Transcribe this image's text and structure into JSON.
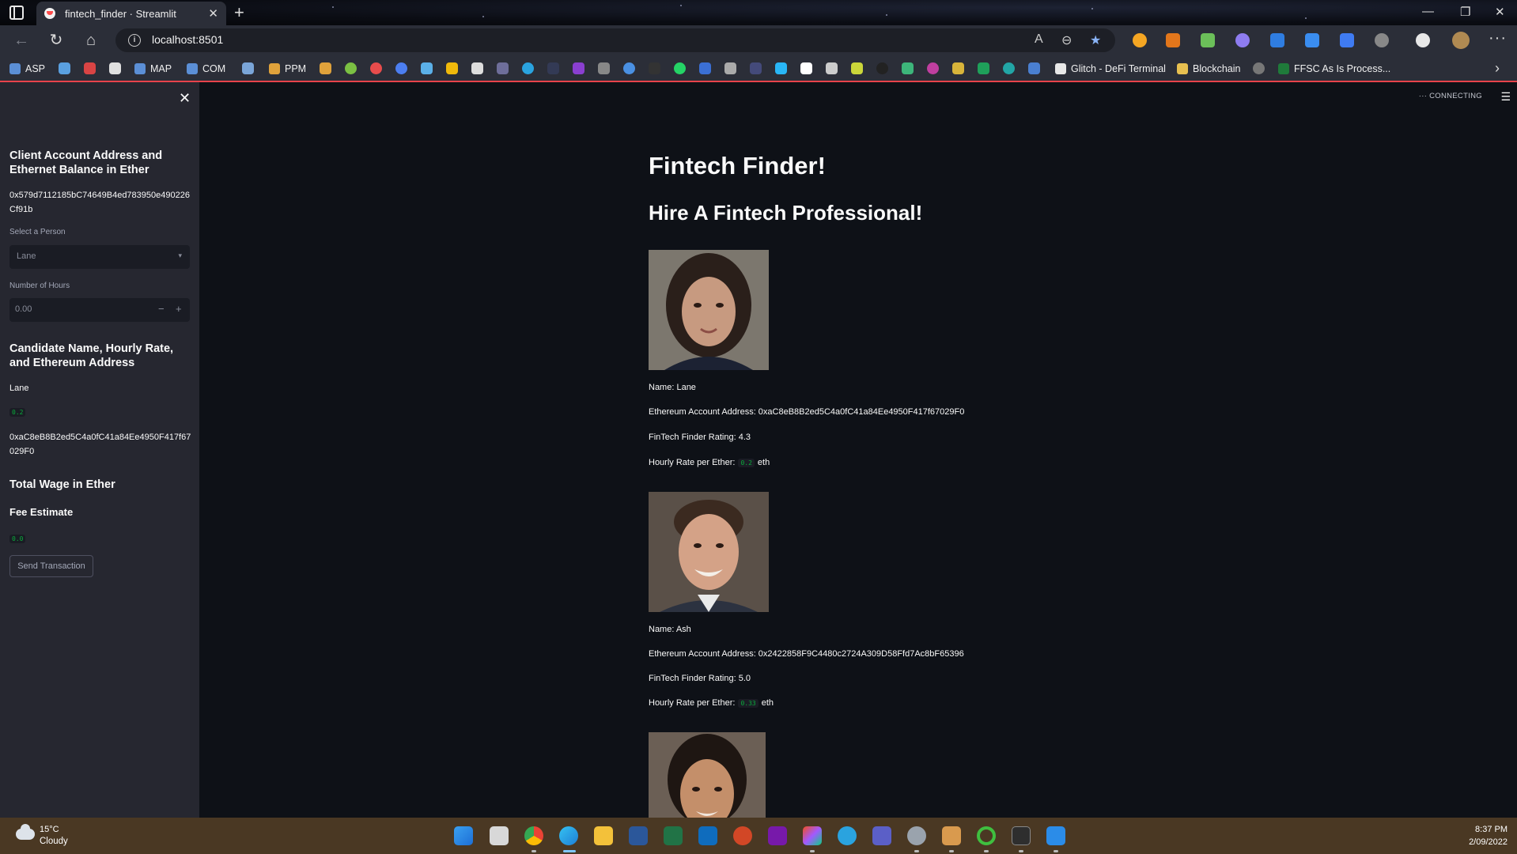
{
  "browser": {
    "tab_title": "fintech_finder · Streamlit",
    "url": "localhost:8501",
    "bookmarks": [
      {
        "label": "ASP",
        "color": "#5b8fd6"
      },
      {
        "label": "MAP",
        "color": "#5b8fd6"
      },
      {
        "label": "COM",
        "color": "#5b8fd6"
      },
      {
        "label": "PPM",
        "color": "#e0a23b"
      },
      {
        "label": "Glitch - DeFi Terminal",
        "color": "#e8e8e8"
      },
      {
        "label": "Blockchain",
        "color": "#e8c050"
      },
      {
        "label": "FFSC As Is Process...",
        "color": "#1f7a3a"
      }
    ]
  },
  "sidebar": {
    "account_heading": "Client Account Address and Ethernet Balance in Ether",
    "account_address": "0x579d7112185bC74649B4ed783950e490226Cf91b",
    "select_label": "Select a Person",
    "select_value": "Lane",
    "hours_label": "Number of Hours",
    "hours_value": "0.00",
    "candidate_heading": "Candidate Name, Hourly Rate, and Ethereum Address",
    "candidate_name": "Lane",
    "candidate_rate": "0.2",
    "candidate_address": "0xaC8eB8B2ed5C4a0fC41a84Ee4950F417f67029F0",
    "wage_heading": "Total Wage in Ether",
    "fee_heading": "Fee Estimate",
    "fee_value": "0.0",
    "send_button": "Send Transaction"
  },
  "main": {
    "status": "CONNECTING",
    "title": "Fintech Finder!",
    "subtitle": "Hire A Fintech Professional!",
    "candidates": [
      {
        "name_line": "Name: Lane",
        "address_line": "Ethereum Account Address: 0xaC8eB8B2ed5C4a0fC41a84Ee4950F417f67029F0",
        "rating_line": "FinTech Finder Rating: 4.3",
        "rate_label": "Hourly Rate per Ether:",
        "rate_value": "0.2",
        "rate_unit": "eth"
      },
      {
        "name_line": "Name: Ash",
        "address_line": "Ethereum Account Address: 0x2422858F9C4480c2724A309D58Ffd7Ac8bF65396",
        "rating_line": "FinTech Finder Rating: 5.0",
        "rate_label": "Hourly Rate per Ether:",
        "rate_value": "0.33",
        "rate_unit": "eth"
      }
    ]
  },
  "taskbar": {
    "temperature": "15°C",
    "weather": "Cloudy",
    "time": "8:37 PM",
    "date": "2/09/2022"
  }
}
